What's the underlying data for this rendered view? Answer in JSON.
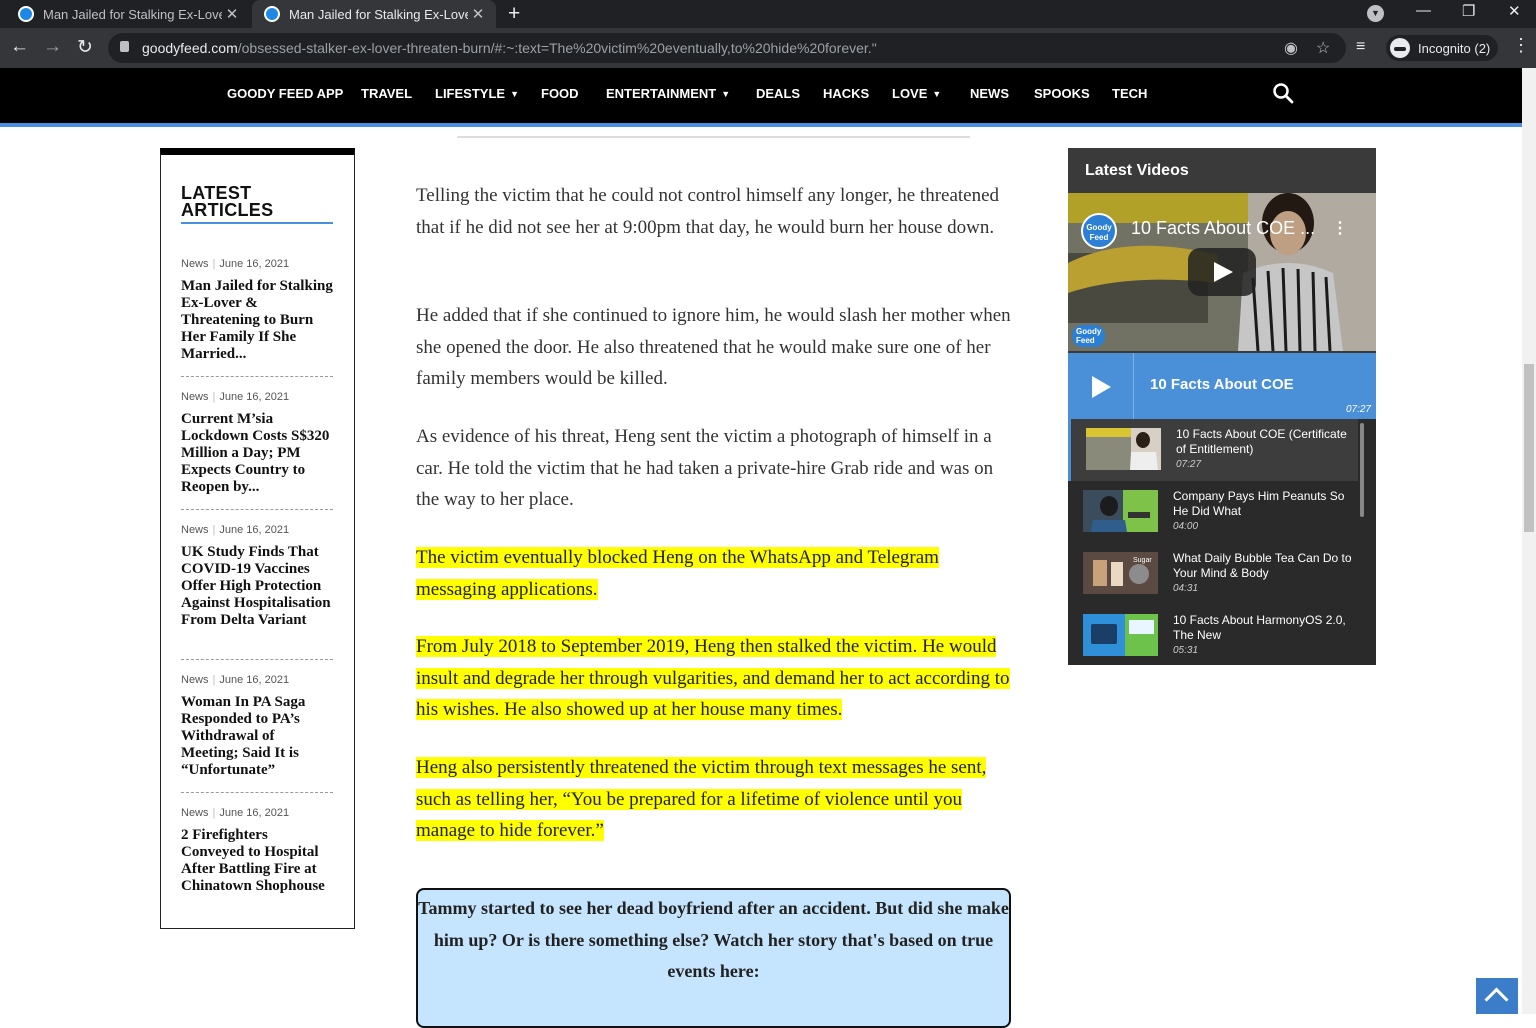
{
  "browser": {
    "tabs": [
      {
        "title": "Man Jailed for Stalking Ex-Lover & Threatening",
        "active": false
      },
      {
        "title": "Man Jailed for Stalking Ex-Lover & Threatening",
        "active": true
      }
    ],
    "url_host": "goodyfeed.com",
    "url_path": "/obsessed-stalker-ex-lover-threaten-burn/#:~:text=The%20victim%20eventually,to%20hide%20forever.\"",
    "incognito_label": "Incognito (2)"
  },
  "site_nav": {
    "items": [
      {
        "label": "GOODY FEED APP",
        "dropdown": false
      },
      {
        "label": "TRAVEL",
        "dropdown": false
      },
      {
        "label": "LIFESTYLE",
        "dropdown": true
      },
      {
        "label": "FOOD",
        "dropdown": false
      },
      {
        "label": "ENTERTAINMENT",
        "dropdown": true
      },
      {
        "label": "DEALS",
        "dropdown": false
      },
      {
        "label": "HACKS",
        "dropdown": false
      },
      {
        "label": "LOVE",
        "dropdown": true
      },
      {
        "label": "NEWS",
        "dropdown": false
      },
      {
        "label": "SPOOKS",
        "dropdown": false
      },
      {
        "label": "TECH",
        "dropdown": false
      }
    ],
    "caret": "▼"
  },
  "latest_articles": {
    "title": "LATEST ARTICLES",
    "items": [
      {
        "category": "News",
        "date": "June 16, 2021",
        "title": "Man Jailed for Stalking Ex-Lover & Threatening to Burn Her Family If She Married..."
      },
      {
        "category": "News",
        "date": "June 16, 2021",
        "title": "Current M’sia Lockdown Costs S$320 Million a Day; PM Expects Country to Reopen by..."
      },
      {
        "category": "News",
        "date": "June 16, 2021",
        "title": "UK Study Finds That COVID-19 Vaccines Offer High Protection Against Hospitalisation From Delta Variant"
      },
      {
        "category": "News",
        "date": "June 16, 2021",
        "title": "Woman In PA Saga Responded to PA’s Withdrawal of Meeting; Said It is “Unfortunate”"
      },
      {
        "category": "News",
        "date": "June 16, 2021",
        "title": "2 Firefighters Conveyed to Hospital After Battling Fire at Chinatown Shophouse"
      }
    ]
  },
  "article": {
    "paragraphs": [
      {
        "text": "Telling the victim that he could not control himself any longer, he threatened that if he did not see her at 9:00pm that day, he would burn her house down.",
        "highlighted": false
      },
      {
        "text": "He added that if she continued to ignore him, he would slash her mother when she opened the door. He also threatened that he would make sure one of her family members would be killed.",
        "highlighted": false
      },
      {
        "text": "As evidence of his threat, Heng sent the victim a photograph of himself in a car. He told the victim that he had taken a private-hire Grab ride and was on the way to her place.",
        "highlighted": false
      },
      {
        "text": "The victim eventually blocked Heng on the WhatsApp and Telegram messaging applications.",
        "highlighted": true
      },
      {
        "text": "From July 2018 to September 2019, Heng then stalked the victim. He would insult and degrade her through vulgarities, and demand her to act according to his wishes. He also showed up at her house many times.",
        "highlighted": true
      },
      {
        "text": "Heng also persistently threatened the victim through text messages he sent, such as telling her, “You be prepared for a lifetime of violence until you manage to hide forever.”",
        "highlighted": true
      }
    ],
    "callout": "Tammy started to see her dead boyfriend after an accident. But did she make him up? Or is there something else? Watch her story that's based on true events here:"
  },
  "videos_widget": {
    "title": "Latest Videos",
    "player_title": "10 Facts About COE ...",
    "player_logo": "Goody Feed",
    "now_playing": {
      "title": "10 Facts About COE",
      "duration": "07:27"
    },
    "items": [
      {
        "title": "10 Facts About COE (Certificate of Entitlement)",
        "duration": "07:27",
        "current": true
      },
      {
        "title": "Company Pays Him Peanuts So He Did What",
        "duration": "04:00",
        "current": false
      },
      {
        "title": "What Daily Bubble Tea Can Do to Your Mind & Body",
        "duration": "04:31",
        "current": false
      },
      {
        "title": "10 Facts About HarmonyOS 2.0, The New",
        "duration": "05:31",
        "current": false
      }
    ],
    "colors": {
      "accent": "#4a90d9",
      "panel": "#3a3a3a"
    }
  },
  "colors": {
    "highlight": "#ffff00",
    "nav_accent": "#4a90e2",
    "callout_bg": "#c5e5ff"
  }
}
